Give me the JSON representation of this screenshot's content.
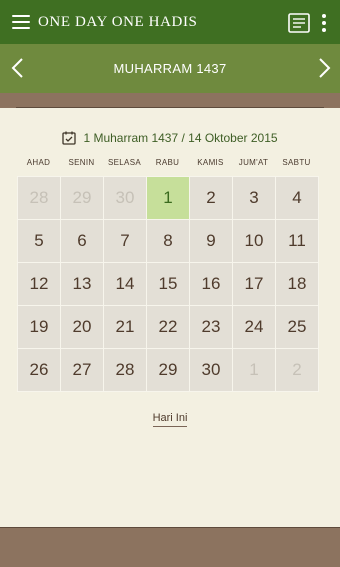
{
  "app": {
    "title": "ONE DAY ONE HADIS",
    "icons": {
      "menu": "hamburger-menu-icon",
      "notes": "notes-icon",
      "more": "more-vert-icon"
    }
  },
  "month": {
    "title": "MUHARRAM 1437",
    "prev_icon": "chevron-left-icon",
    "next_icon": "chevron-right-icon"
  },
  "selected_date": {
    "text": "1 Muharram 1437 / 14 Oktober 2015",
    "icon": "calendar-check-icon"
  },
  "weekdays": [
    "AHAD",
    "SENIN",
    "SELASA",
    "RABU",
    "KAMIS",
    "JUM'AT",
    "SABTU"
  ],
  "calendar": {
    "cells": [
      {
        "day": "28",
        "state": "muted"
      },
      {
        "day": "29",
        "state": "muted"
      },
      {
        "day": "30",
        "state": "muted"
      },
      {
        "day": "1",
        "state": "today"
      },
      {
        "day": "2",
        "state": "normal"
      },
      {
        "day": "3",
        "state": "normal"
      },
      {
        "day": "4",
        "state": "normal"
      },
      {
        "day": "5",
        "state": "normal"
      },
      {
        "day": "6",
        "state": "normal"
      },
      {
        "day": "7",
        "state": "normal"
      },
      {
        "day": "8",
        "state": "normal"
      },
      {
        "day": "9",
        "state": "normal"
      },
      {
        "day": "10",
        "state": "normal"
      },
      {
        "day": "11",
        "state": "normal"
      },
      {
        "day": "12",
        "state": "normal"
      },
      {
        "day": "13",
        "state": "normal"
      },
      {
        "day": "14",
        "state": "normal"
      },
      {
        "day": "15",
        "state": "normal"
      },
      {
        "day": "16",
        "state": "normal"
      },
      {
        "day": "17",
        "state": "normal"
      },
      {
        "day": "18",
        "state": "normal"
      },
      {
        "day": "19",
        "state": "normal"
      },
      {
        "day": "20",
        "state": "normal"
      },
      {
        "day": "21",
        "state": "normal"
      },
      {
        "day": "22",
        "state": "normal"
      },
      {
        "day": "23",
        "state": "normal"
      },
      {
        "day": "24",
        "state": "normal"
      },
      {
        "day": "25",
        "state": "normal"
      },
      {
        "day": "26",
        "state": "normal"
      },
      {
        "day": "27",
        "state": "normal"
      },
      {
        "day": "28",
        "state": "normal"
      },
      {
        "day": "29",
        "state": "normal"
      },
      {
        "day": "30",
        "state": "normal"
      },
      {
        "day": "1",
        "state": "muted"
      },
      {
        "day": "2",
        "state": "muted"
      }
    ]
  },
  "today_button": {
    "label": "Hari Ini"
  },
  "colors": {
    "appbar": "#3f6f22",
    "monthbar": "#6f8a3e",
    "brown": "#8c735f",
    "background": "#f3f0e1",
    "cell": "#e3dfd6",
    "today_cell": "#c6df9a"
  }
}
